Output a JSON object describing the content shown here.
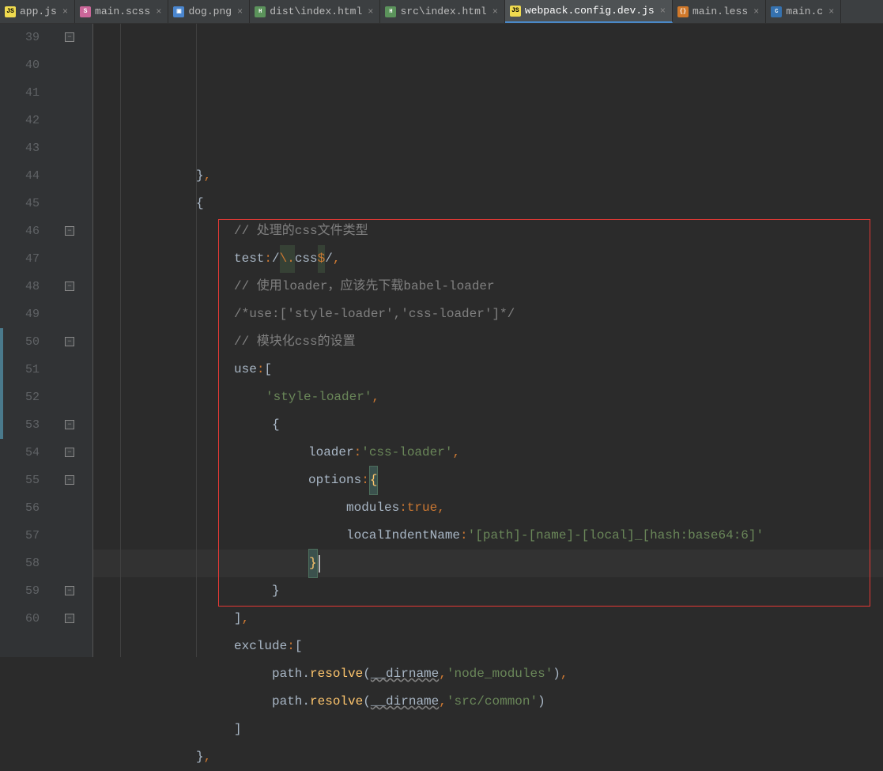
{
  "tabs": [
    {
      "label": "app.js",
      "icon": "js"
    },
    {
      "label": "main.scss",
      "icon": "sass"
    },
    {
      "label": "dog.png",
      "icon": "img"
    },
    {
      "label": "dist\\index.html",
      "icon": "html"
    },
    {
      "label": "src\\index.html",
      "icon": "html"
    },
    {
      "label": "webpack.config.dev.js",
      "icon": "js",
      "active": true
    },
    {
      "label": "main.less",
      "icon": "less"
    },
    {
      "label": "main.c",
      "icon": "css"
    }
  ],
  "lineStart": 39,
  "lineEnd": 60,
  "code": {
    "l39": {
      "ind": 130,
      "parts": [
        {
          "t": "}",
          "c": "c-white"
        },
        {
          "t": ",",
          "c": "c-punc"
        }
      ]
    },
    "l40": {
      "ind": 130,
      "parts": [
        {
          "t": "{",
          "c": "c-white"
        }
      ]
    },
    "l41": {
      "ind": 178,
      "parts": [
        {
          "t": "// 处理的css文件类型",
          "c": "c-comment"
        }
      ]
    },
    "l42": {
      "ind": 178,
      "parts": [
        {
          "t": "test",
          "c": "c-default"
        },
        {
          "t": ":",
          "c": "c-punc"
        },
        {
          "t": "/",
          "c": "c-regex"
        },
        {
          "t": "\\.",
          "c": "c-regex-esc"
        },
        {
          "t": "css",
          "c": "c-regex"
        },
        {
          "t": "$",
          "c": "c-regex-dollar"
        },
        {
          "t": "/",
          "c": "c-regex"
        },
        {
          "t": ",",
          "c": "c-punc"
        }
      ]
    },
    "l43": {
      "ind": 178,
      "parts": [
        {
          "t": "// 使用loader，应该先下载babel-loader",
          "c": "c-comment"
        }
      ]
    },
    "l44": {
      "ind": 178,
      "parts": [
        {
          "t": "/*use:['style-loader','css-loader']*/",
          "c": "c-comment"
        }
      ]
    },
    "l45": {
      "ind": 178,
      "parts": [
        {
          "t": "// 模块化css的设置",
          "c": "c-comment"
        }
      ]
    },
    "l46": {
      "ind": 178,
      "parts": [
        {
          "t": "use",
          "c": "c-default"
        },
        {
          "t": ":",
          "c": "c-punc"
        },
        {
          "t": "[",
          "c": "c-white"
        }
      ]
    },
    "l47": {
      "ind": 218,
      "parts": [
        {
          "t": "'style-loader'",
          "c": "c-str"
        },
        {
          "t": ",",
          "c": "c-punc"
        }
      ]
    },
    "l48": {
      "ind": 226,
      "parts": [
        {
          "t": "{",
          "c": "c-white"
        }
      ]
    },
    "l49": {
      "ind": 272,
      "parts": [
        {
          "t": "loader",
          "c": "c-default"
        },
        {
          "t": ":",
          "c": "c-punc"
        },
        {
          "t": "'css-loader'",
          "c": "c-str"
        },
        {
          "t": ",",
          "c": "c-punc"
        }
      ]
    },
    "l50": {
      "ind": 272,
      "parts": [
        {
          "t": "options",
          "c": "c-default"
        },
        {
          "t": ":",
          "c": "c-punc"
        },
        {
          "t": "{",
          "c": "brace-hl"
        }
      ]
    },
    "l51": {
      "ind": 320,
      "parts": [
        {
          "t": "modules",
          "c": "c-default"
        },
        {
          "t": ":",
          "c": "c-punc"
        },
        {
          "t": "true",
          "c": "c-const"
        },
        {
          "t": ",",
          "c": "c-punc"
        }
      ]
    },
    "l52": {
      "ind": 320,
      "parts": [
        {
          "t": "localIndentName",
          "c": "c-default"
        },
        {
          "t": ":",
          "c": "c-punc"
        },
        {
          "t": "'[path]-[name]-[local]_[hash:base64:6]'",
          "c": "c-str"
        }
      ]
    },
    "l53": {
      "ind": 272,
      "parts": [
        {
          "t": "}",
          "c": "brace-hl"
        }
      ],
      "current": true
    },
    "l54": {
      "ind": 226,
      "parts": [
        {
          "t": "}",
          "c": "c-white"
        }
      ]
    },
    "l55": {
      "ind": 178,
      "parts": [
        {
          "t": "]",
          "c": "c-white"
        },
        {
          "t": ",",
          "c": "c-punc"
        }
      ]
    },
    "l56": {
      "ind": 178,
      "parts": [
        {
          "t": "exclude",
          "c": "c-default"
        },
        {
          "t": ":",
          "c": "c-punc"
        },
        {
          "t": "[",
          "c": "c-white"
        }
      ]
    },
    "l57": {
      "ind": 226,
      "parts": [
        {
          "t": "path.",
          "c": "c-default"
        },
        {
          "t": "resolve",
          "c": "c-method"
        },
        {
          "t": "(",
          "c": "c-white"
        },
        {
          "t": "__dirname",
          "c": "c-param"
        },
        {
          "t": ",",
          "c": "c-punc"
        },
        {
          "t": "'node_modules'",
          "c": "c-str"
        },
        {
          "t": ")",
          "c": "c-white"
        },
        {
          "t": ",",
          "c": "c-punc"
        }
      ]
    },
    "l58": {
      "ind": 226,
      "parts": [
        {
          "t": "path.",
          "c": "c-default"
        },
        {
          "t": "resolve",
          "c": "c-method"
        },
        {
          "t": "(",
          "c": "c-white"
        },
        {
          "t": "__dirname",
          "c": "c-param"
        },
        {
          "t": ",",
          "c": "c-punc"
        },
        {
          "t": "'src/common'",
          "c": "c-str"
        },
        {
          "t": ")",
          "c": "c-white"
        }
      ]
    },
    "l59": {
      "ind": 178,
      "parts": [
        {
          "t": "]",
          "c": "c-white"
        }
      ]
    },
    "l60": {
      "ind": 130,
      "parts": [
        {
          "t": "}",
          "c": "c-white"
        },
        {
          "t": ",",
          "c": "c-punc"
        }
      ]
    }
  },
  "foldMarkers": [
    39,
    46,
    48,
    50,
    53,
    54,
    55,
    59,
    60
  ],
  "vcsMarks": {
    "start": 50,
    "end": 53
  },
  "redBox": {
    "topLine": 46,
    "bottomLine": 59
  },
  "cursor": {
    "line": 53,
    "afterCloseBrace": true
  }
}
